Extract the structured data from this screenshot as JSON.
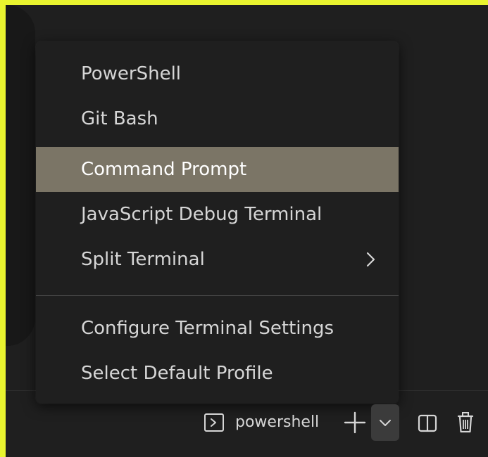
{
  "colors": {
    "outer_border": "#e9f42f",
    "background": "#1f1f1f",
    "menu_background": "#1f1f1f",
    "menu_text": "#d6d6d6",
    "selected_background": "#7b7566",
    "selected_text": "#ffffff",
    "divider": "#4a4a4a"
  },
  "menu": {
    "items": [
      {
        "label": "PowerShell"
      },
      {
        "label": "Git Bash"
      },
      {
        "label": "Command Prompt",
        "selected": true
      },
      {
        "label": "JavaScript Debug Terminal"
      },
      {
        "label": "Split Terminal",
        "submenu": true
      }
    ],
    "footer_items": [
      {
        "label": "Configure Terminal Settings"
      },
      {
        "label": "Select Default Profile"
      }
    ]
  },
  "toolbar": {
    "terminal_label": "powershell",
    "icons": [
      "terminal-icon",
      "plus-icon",
      "chevron-down-icon",
      "split-editor-icon",
      "trash-icon"
    ]
  }
}
